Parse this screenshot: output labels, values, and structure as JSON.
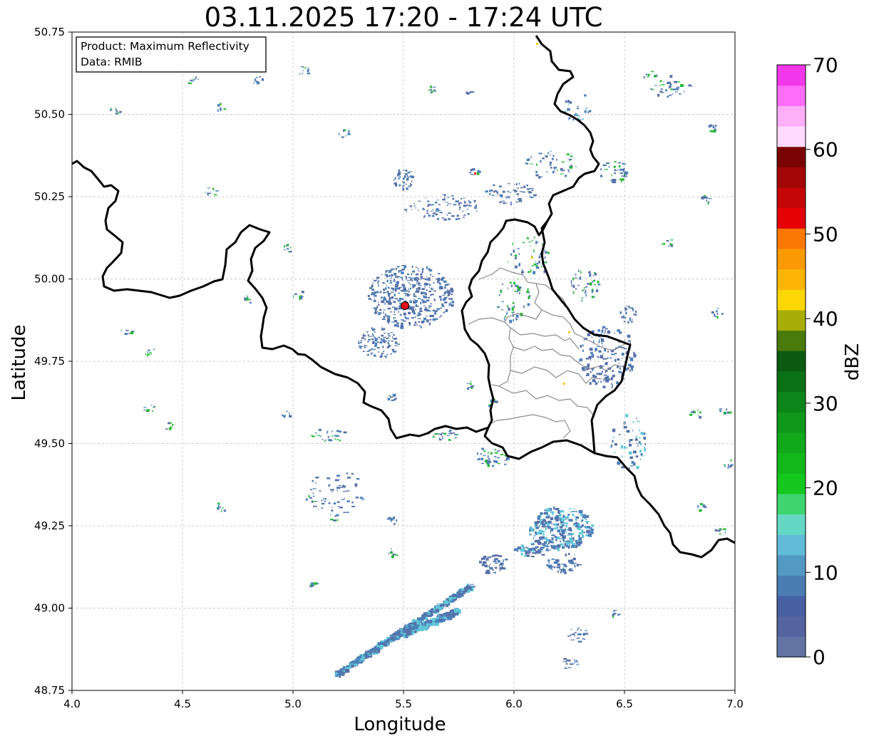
{
  "title": "03.11.2025 17:20 - 17:24 UTC",
  "info_box": {
    "product": "Product: Maximum Reflectivity",
    "source": "Data: RMIB"
  },
  "axes": {
    "xlabel": "Longitude",
    "ylabel": "Latitude",
    "xlim": [
      4.0,
      7.0
    ],
    "ylim": [
      48.75,
      50.75
    ],
    "xticks": [
      "4.0",
      "4.5",
      "5.0",
      "5.5",
      "6.0",
      "6.5",
      "7.0"
    ],
    "yticks": [
      "48.75",
      "49.00",
      "49.25",
      "49.50",
      "49.75",
      "50.00",
      "50.25",
      "50.50",
      "50.75"
    ],
    "grid": true
  },
  "marker": {
    "lon": 5.505,
    "lat": 49.92,
    "color": "#e8101a"
  },
  "colorbar": {
    "label": "dBZ",
    "range": [
      0,
      70
    ],
    "ticks": [
      "0",
      "10",
      "20",
      "30",
      "40",
      "50",
      "60",
      "70"
    ],
    "colors": [
      "#6373a4",
      "#5464a0",
      "#4660a2",
      "#4a7cb2",
      "#5299c3",
      "#60bcd8",
      "#64d8c4",
      "#3ed56e",
      "#14c81e",
      "#12b81a",
      "#11a81a",
      "#0f981a",
      "#0d8619",
      "#0b7016",
      "#0a5a12",
      "#4a7a0a",
      "#a8ae08",
      "#fdd606",
      "#fcb406",
      "#fc9a06",
      "#fc7804",
      "#e40205",
      "#c40606",
      "#a20606",
      "#7a0404",
      "#ffdaff",
      "#ffaef8",
      "#ff6cf8",
      "#f238ea"
    ]
  },
  "echo_colors": {
    "light": "#5670a8",
    "medium": "#4a80b8",
    "cyan": "#60c8d8",
    "green": "#22b830",
    "yellow": "#f0d010",
    "red": "#e02010"
  }
}
